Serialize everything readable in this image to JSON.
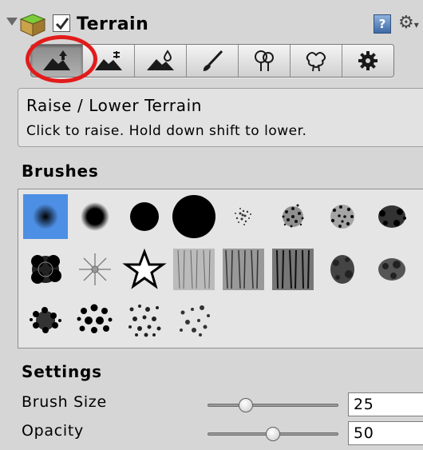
{
  "component": {
    "title": "Terrain",
    "enabled": true,
    "help_icon": "?"
  },
  "toolbar": {
    "tools": [
      {
        "name": "raise-lower-terrain",
        "icon": "mountain-up-arrow-icon",
        "active": true
      },
      {
        "name": "paint-height",
        "icon": "mountain-height-icon",
        "active": false
      },
      {
        "name": "smooth-height",
        "icon": "mountain-drop-icon",
        "active": false
      },
      {
        "name": "paint-texture",
        "icon": "brush-icon",
        "active": false
      },
      {
        "name": "place-trees",
        "icon": "tree-icon",
        "active": false
      },
      {
        "name": "paint-details",
        "icon": "grass-detail-icon",
        "active": false
      },
      {
        "name": "settings",
        "icon": "gear-icon",
        "active": false
      }
    ]
  },
  "description": {
    "title": "Raise / Lower Terrain",
    "text": "Click to raise. Hold down shift to lower."
  },
  "brushes": {
    "label": "Brushes",
    "selected_index": 0,
    "count": 20
  },
  "settings": {
    "label": "Settings",
    "brush_size": {
      "label": "Brush Size",
      "value": "25",
      "slider_fraction": 0.27
    },
    "opacity": {
      "label": "Opacity",
      "value": "50",
      "slider_fraction": 0.5
    }
  },
  "colors": {
    "panel_bg": "#d6d6d6",
    "selected_brush": "#4d8fe5",
    "highlight_ring": "#e21b1b"
  }
}
